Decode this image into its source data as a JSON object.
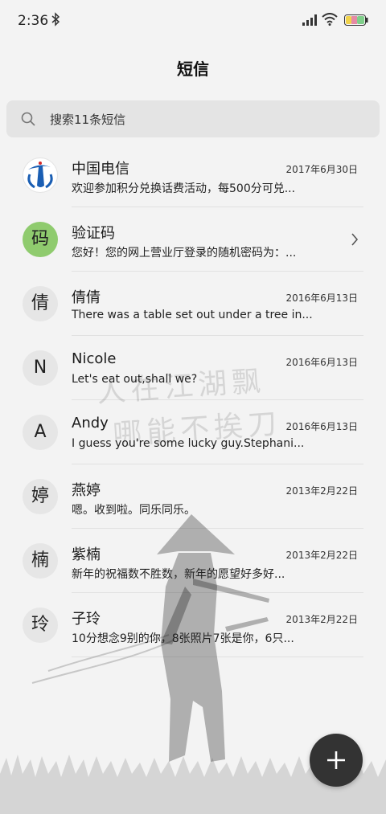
{
  "status_bar": {
    "time": "2:36",
    "icons": [
      "bluetooth-icon",
      "signal-icon",
      "wifi-icon",
      "battery-icon"
    ]
  },
  "header": {
    "title": "短信"
  },
  "search": {
    "placeholder": "搜索11条短信"
  },
  "background": {
    "calligraphy_line1": "人在江湖飘",
    "calligraphy_line2": "哪能不挨刀"
  },
  "messages": [
    {
      "avatar": "",
      "avatar_type": "logo",
      "sender": "中国电信",
      "date": "2017年6月30日",
      "preview": "欢迎参加积分兑换话费活动，每500分可兑..."
    },
    {
      "avatar": "码",
      "avatar_type": "green",
      "sender": "验证码",
      "date": "",
      "preview": "您好！您的网上营业厅登录的随机密码为：..."
    },
    {
      "avatar": "倩",
      "avatar_type": "plain",
      "sender": "倩倩",
      "date": "2016年6月13日",
      "preview": "There was a table set out under a tree in..."
    },
    {
      "avatar": "N",
      "avatar_type": "plain",
      "sender": "Nicole",
      "date": "2016年6月13日",
      "preview": "Let's eat out,shall we?"
    },
    {
      "avatar": "A",
      "avatar_type": "plain",
      "sender": "Andy",
      "date": "2016年6月13日",
      "preview": "I guess you're some lucky guy.Stephani..."
    },
    {
      "avatar": "婷",
      "avatar_type": "plain",
      "sender": "燕婷",
      "date": "2013年2月22日",
      "preview": "嗯。收到啦。同乐同乐。"
    },
    {
      "avatar": "楠",
      "avatar_type": "plain",
      "sender": "紫楠",
      "date": "2013年2月22日",
      "preview": "新年的祝福数不胜数，新年的愿望好多好..."
    },
    {
      "avatar": "玲",
      "avatar_type": "plain",
      "sender": "子玲",
      "date": "2013年2月22日",
      "preview": "10分想念9别的你，8张照片7张是你，6只..."
    }
  ],
  "fab": {
    "icon": "plus-icon"
  },
  "colors": {
    "background": "#f3f3f3",
    "search_bg": "#e4e4e4",
    "verify_avatar": "#8fcb6e",
    "fab": "#333333"
  }
}
